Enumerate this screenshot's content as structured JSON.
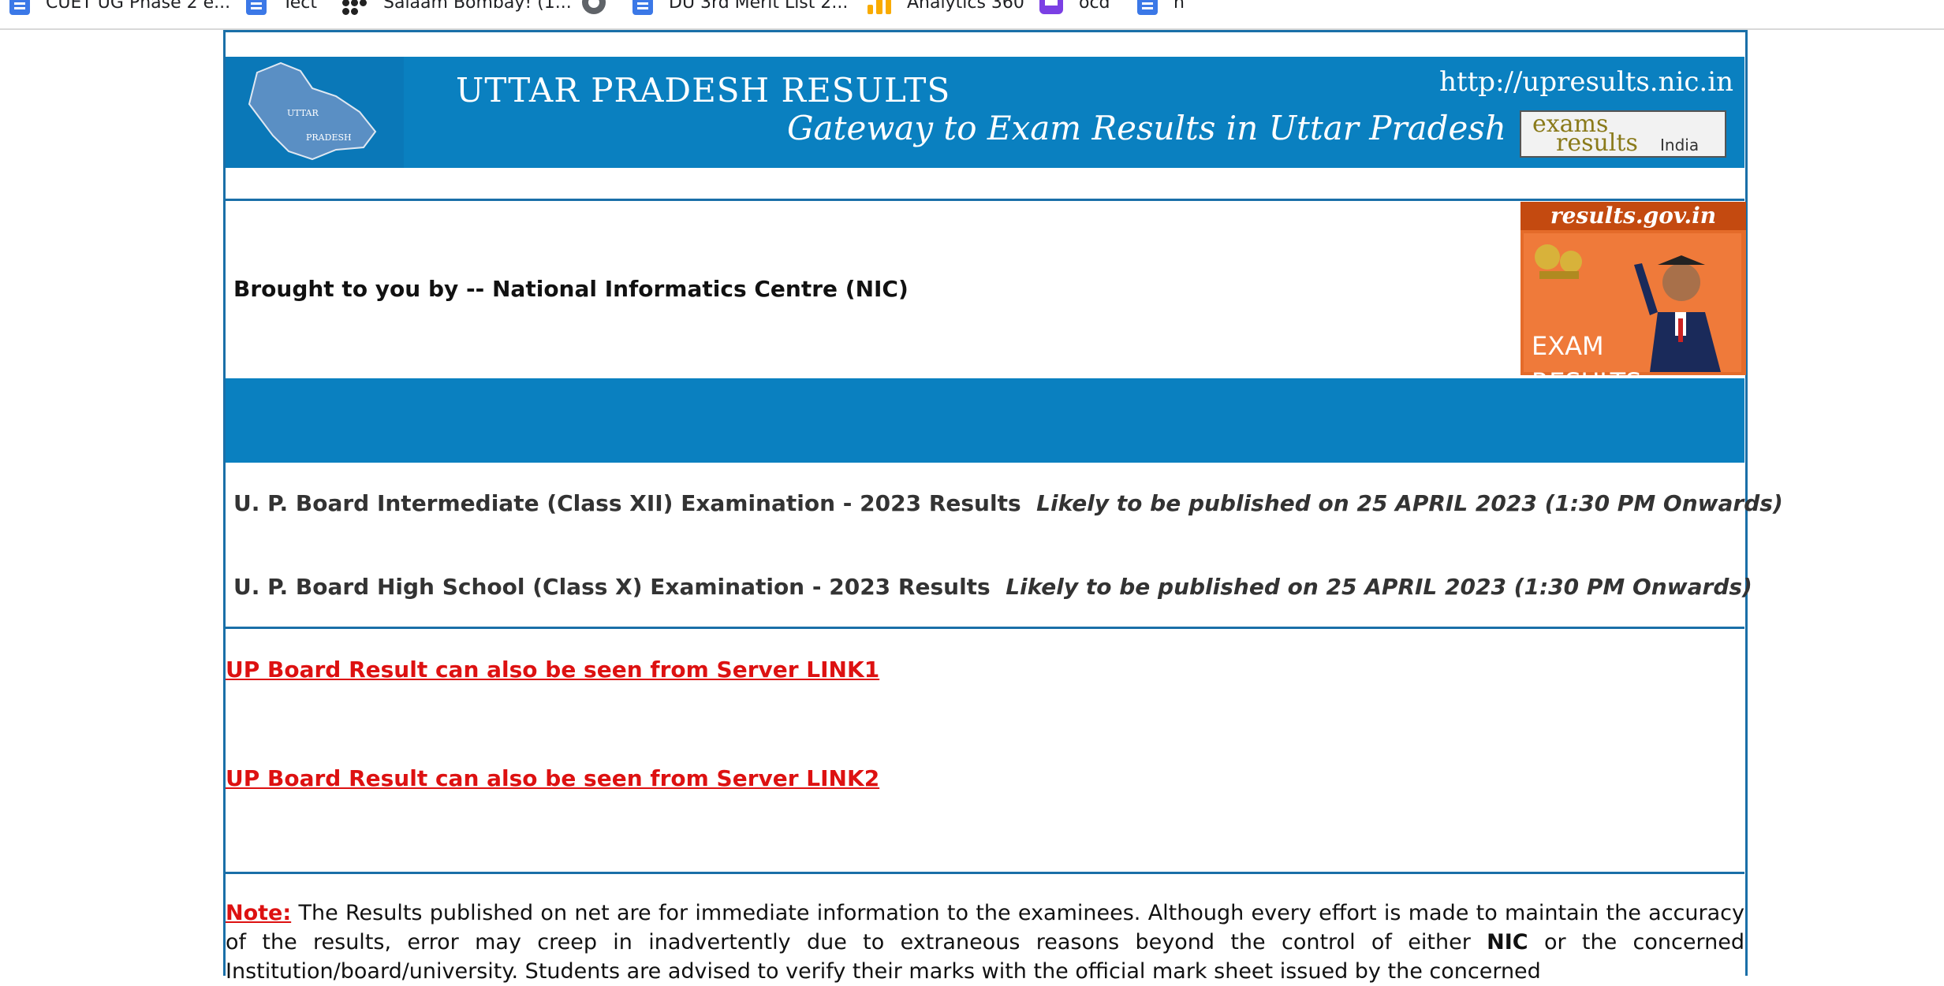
{
  "bookmarks": [
    {
      "label": "CUET UG Phase 2 e...",
      "icon": "google-docs-icon"
    },
    {
      "label": "Tect",
      "icon": "google-docs-icon"
    },
    {
      "label": "Salaam Bombay! (1...",
      "icon": "dots-logo-icon"
    },
    {
      "label": "",
      "icon": "globe-icon"
    },
    {
      "label": "DU 3rd Merit List 2...",
      "icon": "google-docs-icon"
    },
    {
      "label": "Analytics 360",
      "icon": "analytics-icon"
    },
    {
      "label": "ocd",
      "icon": "printer-icon"
    },
    {
      "label": "h",
      "icon": "google-docs-icon"
    }
  ],
  "banner": {
    "title": "UTTAR PRADESH RESULTS",
    "tagline": "Gateway to Exam Results in Uttar Pradesh",
    "url": "http://upresults.nic.in",
    "map_label_top": "UTTAR",
    "map_label_bottom": "PRADESH",
    "exams_logo": {
      "word1": "exams",
      "word2": "results",
      "word3": "India"
    }
  },
  "brought_by": "Brought to you by -- National Informatics Centre (NIC)",
  "results_gov": {
    "header": "results.gov.in",
    "line1": "EXAM",
    "line2": "RESULTS"
  },
  "announcements": [
    {
      "title": "U. P. Board Intermediate (Class XII) Examination  - 2023 Results",
      "status": "Likely to be published on 25 APRIL 2023 (1:30 PM Onwards)"
    },
    {
      "title": "U. P. Board High School (Class X) Examination - 2023 Results",
      "status": "Likely to be published on 25 APRIL 2023 (1:30 PM Onwards)"
    }
  ],
  "server_links": [
    "UP Board Result can also be seen from Server LINK1",
    "UP Board Result can also be seen from Server LINK2"
  ],
  "note": {
    "label": "Note:",
    "text1": " The Results published on net are for immediate information to the examinees. Although every effort is made to maintain the accuracy of the results, error may creep in inadvertently due to extraneous reasons beyond the control of either ",
    "bold": "NIC",
    "text2": " or the concerned Institution/board/university. Students are advised to verify their marks with the official mark sheet issued by the concerned"
  },
  "colors": {
    "banner_blue": "#0a80c0",
    "frame_blue": "#1a6fa8",
    "link_red": "#d11111",
    "results_orange": "#e46b2a"
  }
}
